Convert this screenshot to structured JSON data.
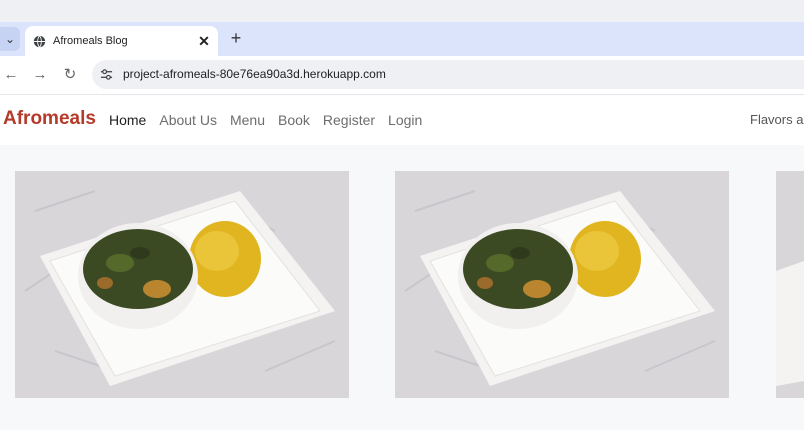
{
  "browser": {
    "tab_title": "Afromeals Blog",
    "url": "project-afromeals-80e76ea90a3d.herokuapp.com",
    "icons": [
      "chevron-down-icon",
      "globe-icon",
      "close-icon",
      "plus-icon",
      "back-icon",
      "forward-icon",
      "reload-icon",
      "site-settings-icon"
    ]
  },
  "site": {
    "brand": "Afromeals",
    "brand_color": "#b43a2a",
    "nav": [
      {
        "label": "Home",
        "active": true
      },
      {
        "label": "About Us"
      },
      {
        "label": "Menu"
      },
      {
        "label": "Book"
      },
      {
        "label": "Register"
      },
      {
        "label": "Login"
      }
    ],
    "tagline": "Flavors ar"
  }
}
